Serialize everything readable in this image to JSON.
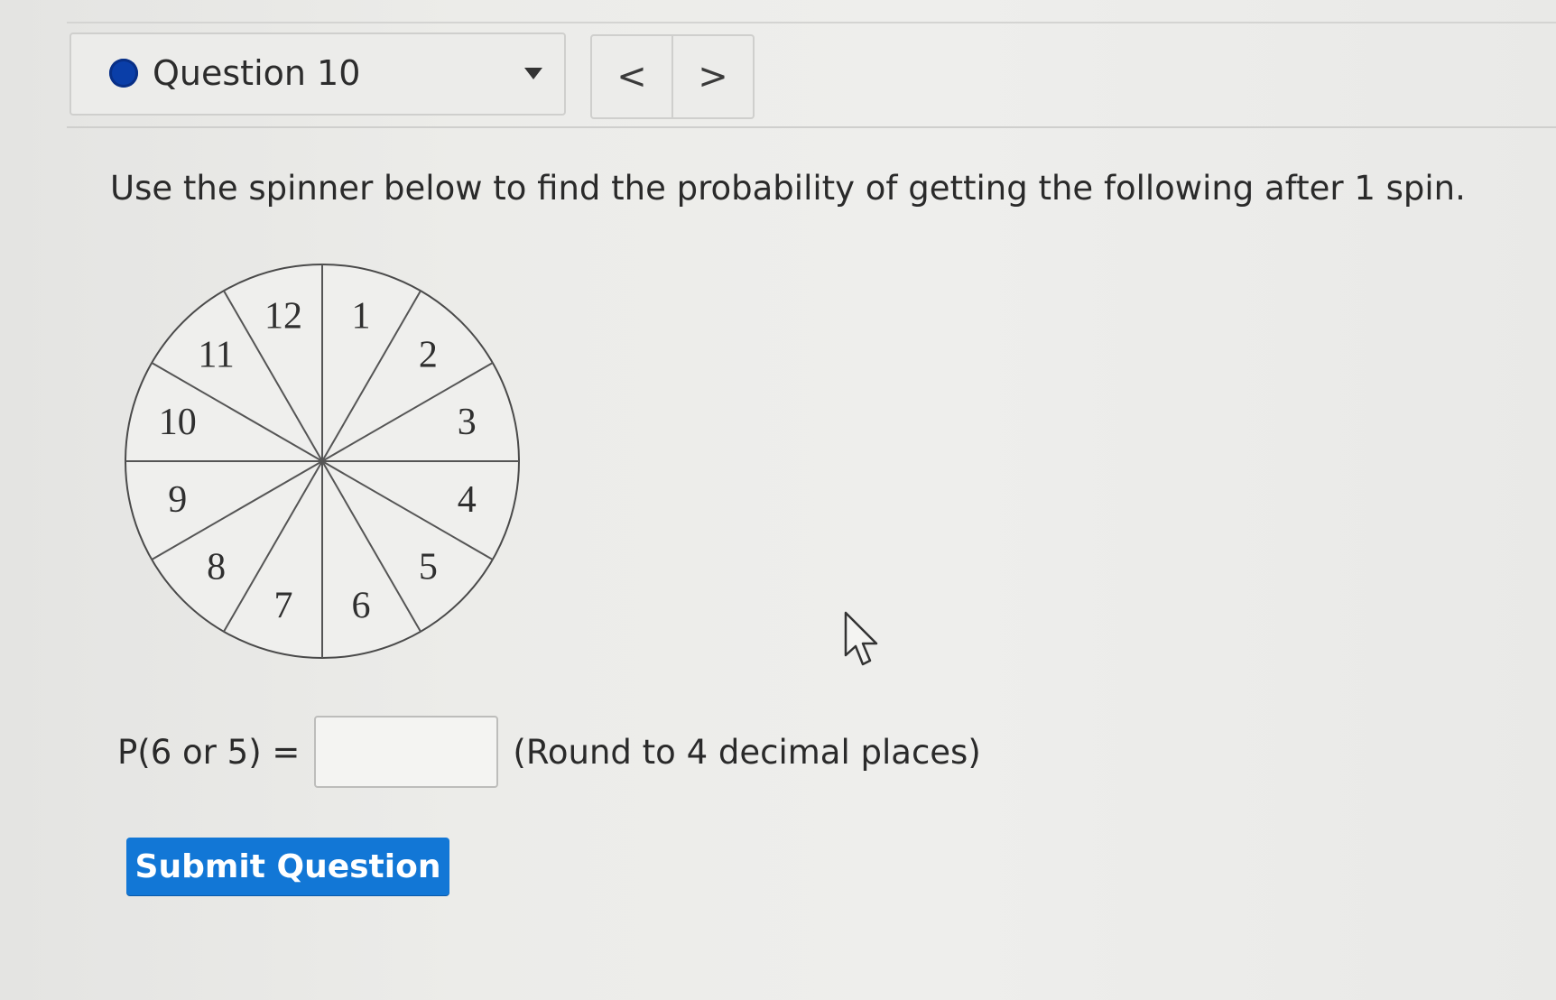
{
  "header": {
    "question_label": "Question 10",
    "status_color": "#0a3ea8",
    "prev_icon": "chevron-left-icon",
    "next_icon": "chevron-right-icon",
    "prev_glyph": "<",
    "next_glyph": ">"
  },
  "prompt": "Use the spinner below to find the probability of getting the following after 1 spin.",
  "spinner": {
    "sections": [
      "1",
      "2",
      "3",
      "4",
      "5",
      "6",
      "7",
      "8",
      "9",
      "10",
      "11",
      "12"
    ]
  },
  "answer": {
    "label": "P(6 or 5) =",
    "value": "",
    "hint": "(Round to 4 decimal places)"
  },
  "submit_label": "Submit Question",
  "accent_color": "#1277d6"
}
